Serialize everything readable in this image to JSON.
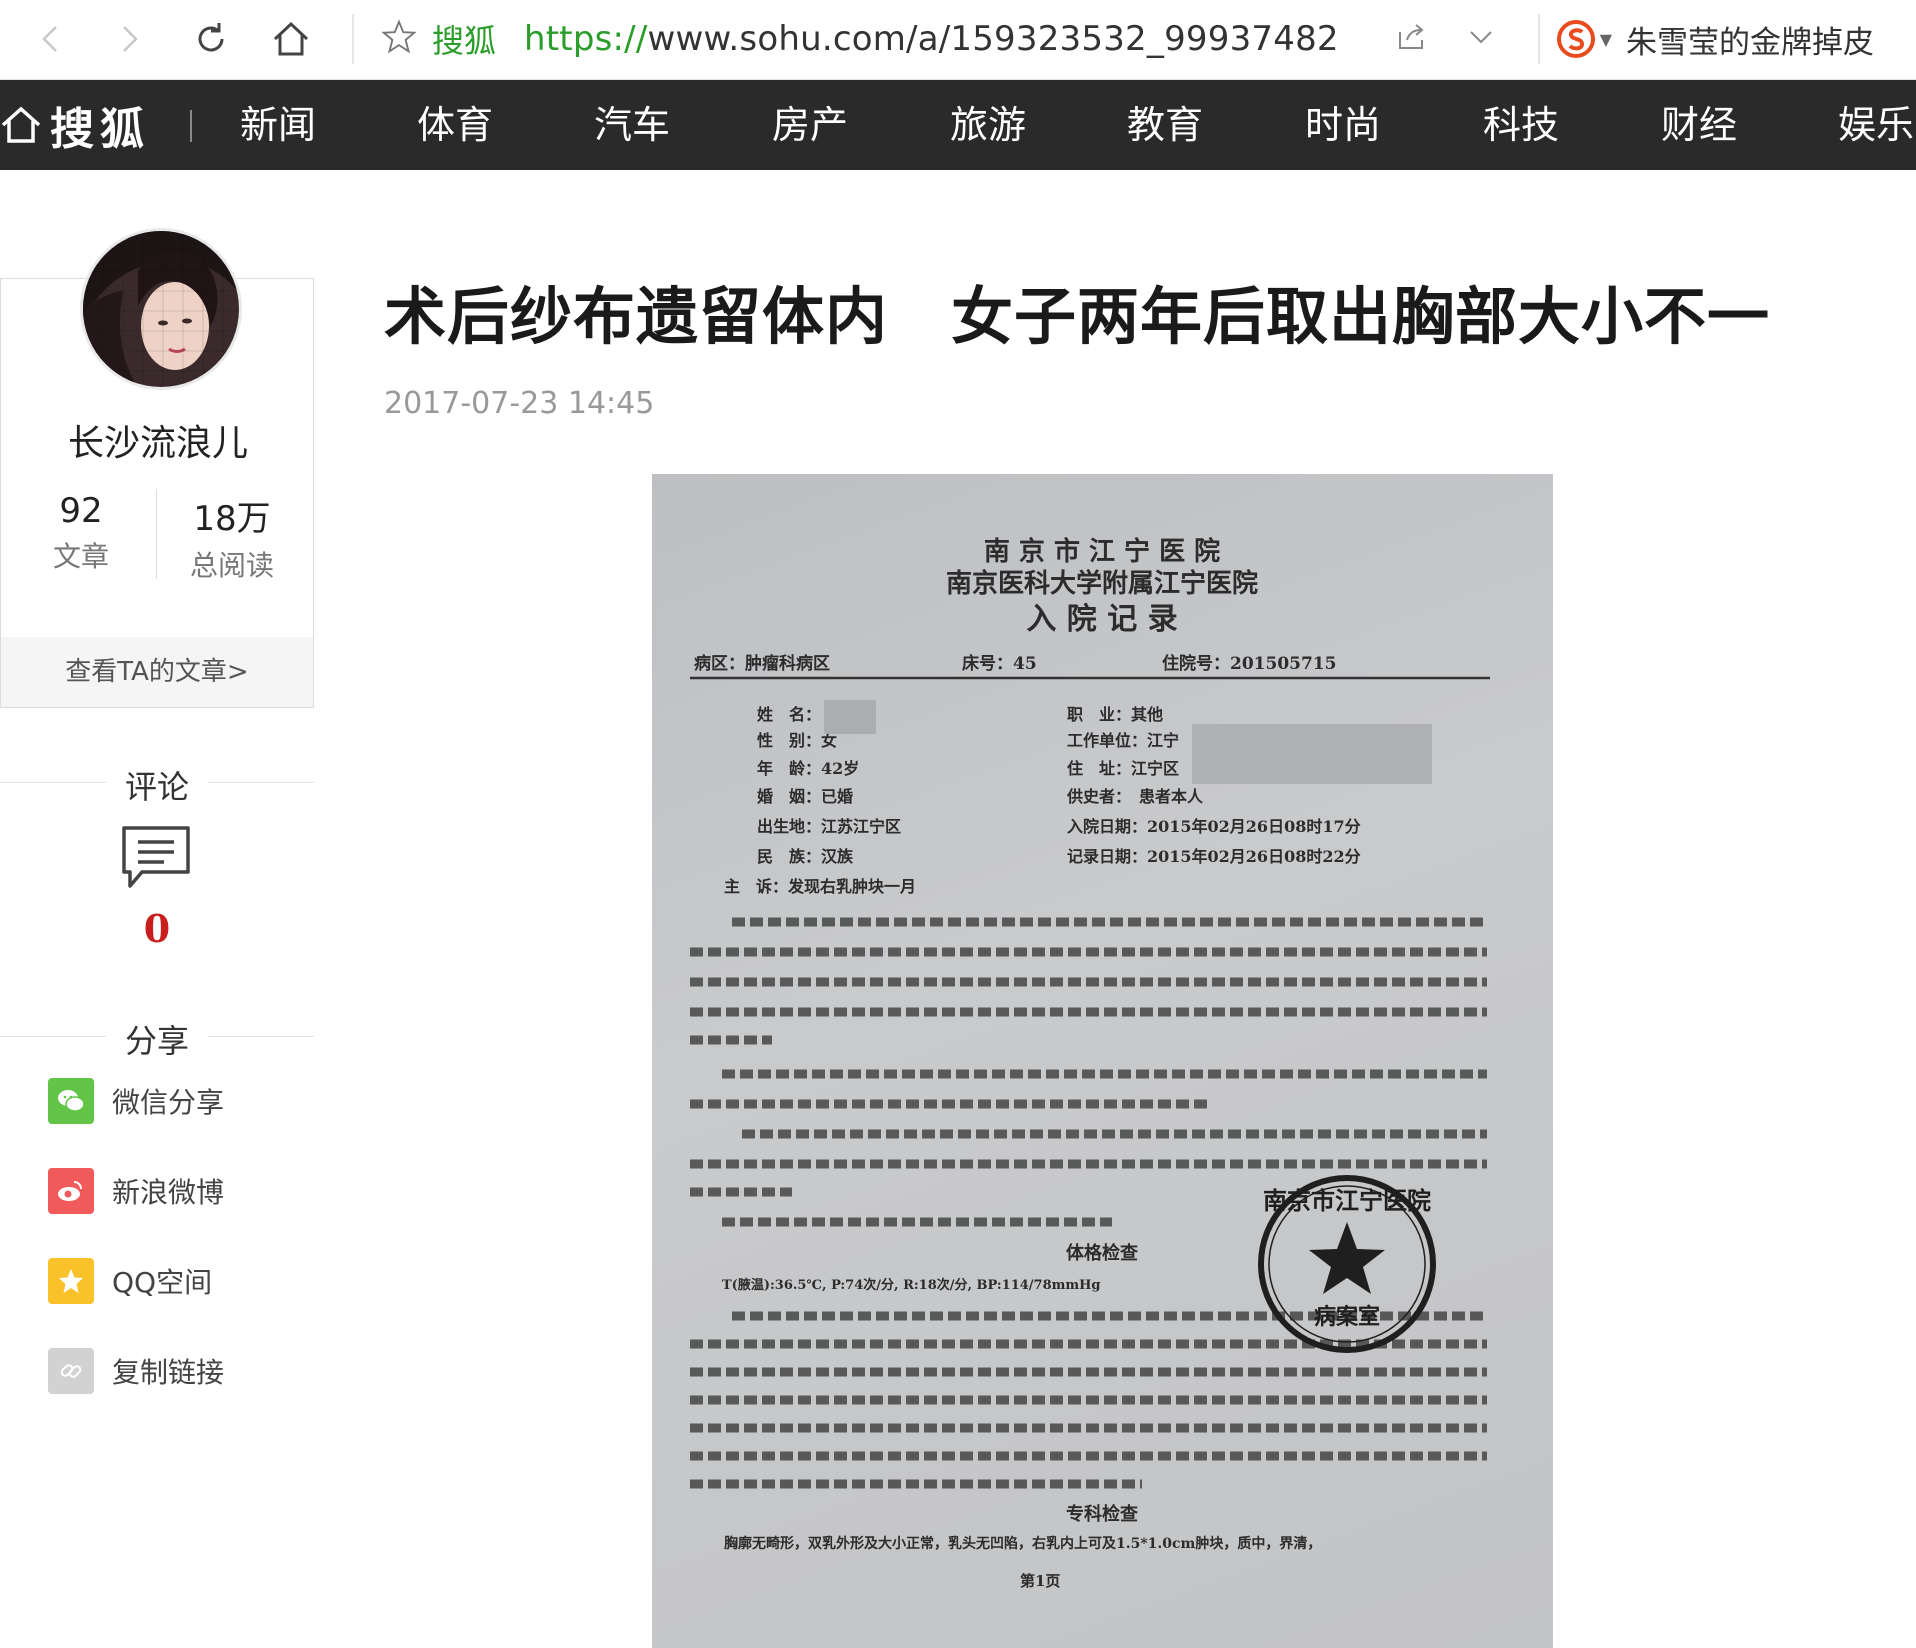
{
  "browser": {
    "url_site_label": "搜狐",
    "url_protocol": "https://",
    "url_rest": "www.sohu.com/a/159323532_99937482",
    "hot_search": "朱雪莹的金牌掉皮"
  },
  "site_nav": {
    "logo_text": "搜狐",
    "items": [
      "新闻",
      "体育",
      "汽车",
      "房产",
      "旅游",
      "教育",
      "时尚",
      "科技",
      "财经",
      "娱乐"
    ]
  },
  "author": {
    "name": "长沙流浪儿",
    "articles_count": "92",
    "articles_label": "文章",
    "reads_count": "18万",
    "reads_label": "总阅读",
    "view_link": "查看TA的文章>"
  },
  "comments": {
    "heading": "评论",
    "count": "0"
  },
  "share": {
    "heading": "分享",
    "items": [
      {
        "label": "微信分享",
        "icon": "wechat-icon",
        "color": "#62c548"
      },
      {
        "label": "新浪微博",
        "icon": "weibo-icon",
        "color": "#f05a5a"
      },
      {
        "label": "QQ空间",
        "icon": "qzone-icon",
        "color": "#f9c22b"
      },
      {
        "label": "复制链接",
        "icon": "link-icon",
        "color": "#cfcfcf"
      }
    ]
  },
  "article": {
    "title": "术后纱布遗留体内　女子两年后取出胸部大小不一",
    "date": "2017-07-23 14:45"
  },
  "document_image": {
    "hospital_line1": "南 京 市 江 宁 医 院",
    "hospital_line2": "南京医科大学附属江宁医院",
    "record_title": "入 院 记 录",
    "ward": "病区：肿瘤科病区",
    "bed": "床号：45",
    "admission_no": "住院号：201505715",
    "field_name": "姓　名：",
    "field_sex": "性　别：女",
    "field_age": "年　龄：42岁",
    "field_marriage": "婚　姻：已婚",
    "field_birthplace": "出生地：江苏江宁区",
    "field_ethnicity": "民　族：汉族",
    "field_job": "职　业：其他",
    "field_workplace": "工作单位：江宁",
    "field_address": "住　址：江宁区",
    "field_informant": "供史者：　患者本人",
    "field_admit_date": "入院日期：2015年02月26日08时17分",
    "field_record_date": "记录日期：2015年02月26日08时22分",
    "chief_complaint": "主　诉：发现右乳肿块一月",
    "section_exam": "体格检查",
    "section_special": "专科检查",
    "vitals": "T(腋温):36.5℃, P:74次/分, R:18次/分, BP:114/78mmHg",
    "special_text": "胸廓无畸形，双乳外形及大小正常，乳头无凹陷，右乳内上可及1.5*1.0cm肿块，质中，界清，",
    "page_no": "第1页",
    "stamp_text": "南京市江宁医院",
    "stamp_sub": "病案室"
  }
}
